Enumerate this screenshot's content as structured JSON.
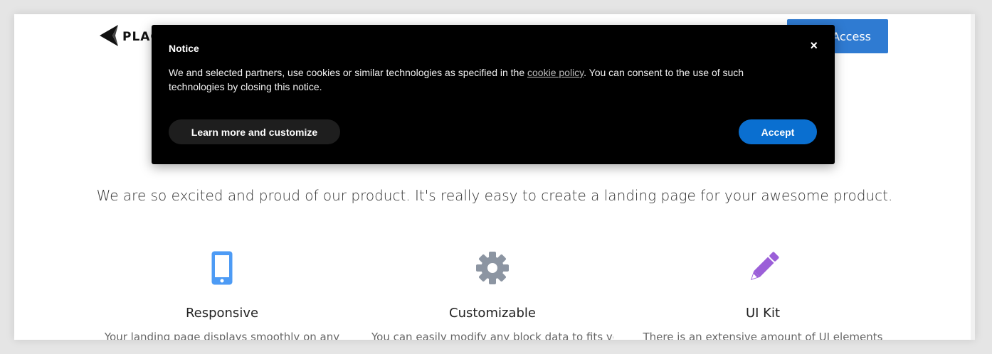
{
  "header": {
    "logo_text": "PLAC",
    "logo_icon": "paper-plane-icon",
    "access_label": "Access"
  },
  "hero": {
    "tagline": "We are so excited and proud of our product. It's really easy to create a landing page for your awesome product."
  },
  "features": [
    {
      "icon": "mobile-phone-icon",
      "color": "#4d9bf5",
      "title": "Responsive",
      "desc": "Your landing page displays smoothly on any"
    },
    {
      "icon": "gear-icon",
      "color": "#8c95a2",
      "title": "Customizable",
      "desc": "You can easily modify any block data to fits your"
    },
    {
      "icon": "pencil-icon",
      "color": "#9b5fd8",
      "title": "UI Kit",
      "desc": "There is an extensive amount of UI elements"
    }
  ],
  "notice": {
    "title": "Notice",
    "body_before": "We and selected partners, use cookies or similar technologies as specified in the ",
    "link_text": "cookie policy",
    "body_after": ". You can consent to the use of such technologies by closing this notice.",
    "close_glyph": "×",
    "learn_label": "Learn more and customize",
    "accept_label": "Accept"
  },
  "colors": {
    "accent": "#2f7bd2",
    "accept": "#0a6fd0",
    "notice_bg": "#000000"
  }
}
